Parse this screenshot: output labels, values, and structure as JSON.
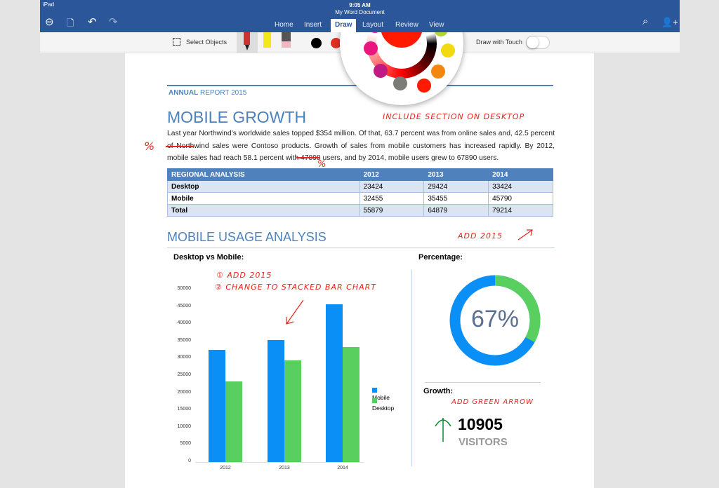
{
  "status": {
    "device": "iPad",
    "time": "9:05 AM"
  },
  "app": {
    "doc_title": "My Word Document"
  },
  "tabs": [
    {
      "label": "Home"
    },
    {
      "label": "Insert"
    },
    {
      "label": "Draw",
      "active": true
    },
    {
      "label": "Layout"
    },
    {
      "label": "Review"
    },
    {
      "label": "View"
    }
  ],
  "toolbar": {
    "select_objects": "Select Objects",
    "draw_with_touch": "Draw with Touch",
    "draw_with_touch_on": false,
    "selected_color": "#ff1a00"
  },
  "palette": {
    "colors": [
      "#e61ab9",
      "#e9167f",
      "#c01a85",
      "#7b7b78",
      "#ff1a00",
      "#f4860f",
      "#f3d90f",
      "#b3d531",
      "#0a8a0a"
    ]
  },
  "doc": {
    "kicker_a": "ANNUAL",
    "kicker_b": " REPORT 2015",
    "title": "MOBILE GROWTH",
    "paragraph": "Last year Northwind’s worldwide sales topped $354 million. Of that, 63.7 percent was from online sales and, 42.5 percent of Northwind sales were Contoso products. Growth of sales from mobile customers has increased rapidly. By 2012, mobile sales had reach 58.1 percent with 47898 users, and by 2014, mobile users grew to 67890 users.",
    "table": {
      "headers": [
        "REGIONAL ANALYSIS",
        "2012",
        "2013",
        "2014"
      ],
      "rows": [
        [
          "Desktop",
          "23424",
          "29424",
          "33424"
        ],
        [
          "Mobile",
          "32455",
          "35455",
          "45790"
        ],
        [
          "Total",
          "55879",
          "64879",
          "79214"
        ]
      ]
    },
    "section2": "MOBILE USAGE ANALYSIS",
    "chart_title": "Desktop vs Mobile:",
    "percentage_title": "Percentage:",
    "percentage_value": "67%",
    "percentage": 67,
    "growth_title": "Growth:",
    "growth_value": "10905",
    "growth_unit": "VISITORS"
  },
  "annotations": {
    "a1": "INCLUDE SECTION ON DESKTOP",
    "a2": "%",
    "a3": "%",
    "a4": "ADD 2015",
    "a5": "① ADD 2015",
    "a6": "② CHANGE TO STACKED BAR CHART",
    "a7": "ADD GREEN ARROW"
  },
  "chart_data": {
    "type": "bar",
    "categories": [
      "2012",
      "2013",
      "2014"
    ],
    "series": [
      {
        "name": "Mobile",
        "values": [
          32455,
          35455,
          45790
        ],
        "color": "#0a8ff7"
      },
      {
        "name": "Desktop",
        "values": [
          23424,
          29424,
          33424
        ],
        "color": "#58cf5e"
      }
    ],
    "ylim": [
      0,
      50000
    ],
    "yticks": [
      0,
      5000,
      10000,
      15000,
      20000,
      25000,
      30000,
      35000,
      40000,
      45000,
      50000
    ],
    "legend": "right",
    "grid": false
  },
  "colors": {
    "accent": "#2b579a",
    "heading": "#4f81bd",
    "ink": "#e8241c",
    "green_ink": "#0a8a2a"
  }
}
